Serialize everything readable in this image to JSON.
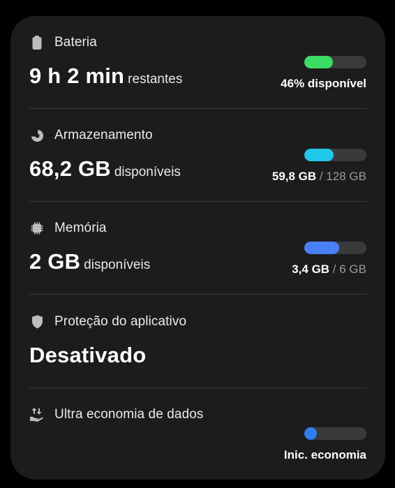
{
  "colors": {
    "card_bg": "#1c1c1e",
    "battery_fill": "#3ddc64",
    "storage_fill": "#1fc7e8",
    "memory_fill": "#4a80f5",
    "data_saver_fill": "#2f7df1",
    "bar_track": "#3a3a3c"
  },
  "battery": {
    "icon": "battery-icon",
    "title": "Bateria",
    "value": "9 h 2 min",
    "value_suffix": "restantes",
    "level_fraction": 0.46,
    "status": "46% disponível"
  },
  "storage": {
    "icon": "storage-pie-icon",
    "title": "Armazenamento",
    "value": "68,2 GB",
    "value_suffix": "disponíveis",
    "used_fraction": 0.467,
    "used": "59,8 GB",
    "total": " / 128 GB"
  },
  "memory": {
    "icon": "memory-chip-icon",
    "title": "Memória",
    "value": "2 GB",
    "value_suffix": "disponíveis",
    "used_fraction": 0.567,
    "used": "3,4 GB",
    "total": " / 6 GB"
  },
  "app_protection": {
    "icon": "shield-icon",
    "title": "Proteção do aplicativo",
    "value": "Desativado"
  },
  "data_saver": {
    "icon": "data-saver-icon",
    "title": "Ultra economia de dados",
    "level_fraction": 0.0,
    "action": "Inic. economia"
  }
}
